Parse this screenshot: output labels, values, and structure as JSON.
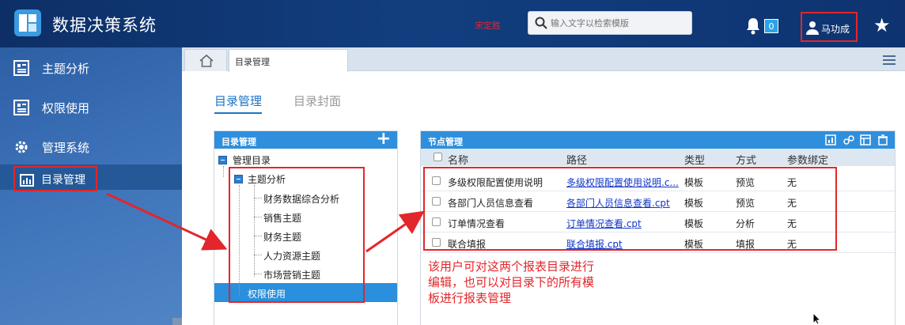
{
  "header": {
    "app_title": "数据决策系统",
    "red_text": "宋定胜",
    "search_placeholder": "输入文字以检索模版",
    "notification_count": "0",
    "user_name": "马功成"
  },
  "sidebar": {
    "items": [
      {
        "label": "主题分析",
        "icon": "report-icon"
      },
      {
        "label": "权限使用",
        "icon": "report-icon"
      },
      {
        "label": "管理系统",
        "icon": "gear-icon"
      }
    ],
    "subitem": {
      "label": "目录管理",
      "icon": "chart-icon"
    }
  },
  "tabs": {
    "home_icon": "home-icon",
    "current": "目录管理"
  },
  "subtabs": [
    "目录管理",
    "目录封面"
  ],
  "tree_panel": {
    "title": "目录管理",
    "root": "管理目录",
    "group": "主题分析",
    "children": [
      "财务数据综合分析",
      "销售主题",
      "财务主题",
      "人力资源主题",
      "市场营销主题"
    ],
    "selected": "权限使用"
  },
  "table_panel": {
    "title": "节点管理",
    "columns": [
      "名称",
      "路径",
      "类型",
      "方式",
      "参数绑定"
    ],
    "rows": [
      {
        "name": "多级权限配置使用说明",
        "path": "多级权限配置使用说明.c...",
        "type": "模板",
        "mode": "预览",
        "param": "无"
      },
      {
        "name": "各部门人员信息查看",
        "path": "各部门人员信息查看.cpt",
        "type": "模板",
        "mode": "预览",
        "param": "无"
      },
      {
        "name": "订单情况查看",
        "path": "订单情况查看.cpt",
        "type": "模板",
        "mode": "分析",
        "param": "无"
      },
      {
        "name": "联合填报",
        "path": "联合填报.cpt",
        "type": "模板",
        "mode": "填报",
        "param": "无"
      }
    ]
  },
  "annotation": [
    "该用户可对这两个报表目录进行",
    "编辑，也可以对目录下的所有模",
    "板进行报表管理"
  ],
  "colors": {
    "accent": "#2f8fdc",
    "annotation_red": "#e2262b",
    "header_bg": "#123e7f"
  }
}
